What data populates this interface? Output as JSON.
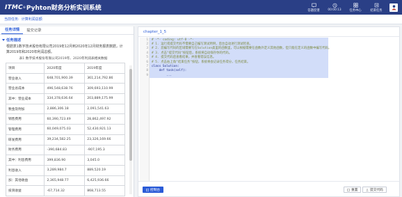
{
  "app": {
    "logo": "ITMC",
    "reg": "®",
    "title": "Pyhton财务分析实训系统"
  },
  "top_actions": [
    {
      "label": "答题反馈",
      "icon": "feedback-icon"
    },
    {
      "label": "00:00:13",
      "icon": "timer-icon"
    },
    {
      "label": "任务中心",
      "icon": "task-center-icon"
    },
    {
      "label": "结束任务",
      "icon": "end-task-icon"
    }
  ],
  "subbar": {
    "label": "当前任务:",
    "value": "计算利润总额"
  },
  "left": {
    "tabs": [
      "任务详情",
      "提交记录"
    ],
    "section_title": "任务描述",
    "description": "根据表1数字技术股份有限公司2019年12月到2020年12月财务报表数据，计算2019年和2020年利润总额。",
    "table_caption": "表1 数字技术股份有限公司2019年、2020年利润表相关数据",
    "table_rows": [
      [
        "项目",
        "2020年度",
        "2019年度"
      ],
      [
        "营业收入",
        "648,701,900.39",
        "361,214,792.86"
      ],
      [
        "营业总成本",
        "496,548,638.76",
        "309,693,110.99"
      ],
      [
        "其中：营业成本",
        "334,378,636.64",
        "203,889,175.99"
      ],
      [
        "税金及附加",
        "2,886,306.18",
        "2,091,541.63"
      ],
      [
        "销售费用",
        "60,390,723.49",
        "28,862,497.92"
      ],
      [
        "管理费用",
        "60,049,075.03",
        "52,430,921.13"
      ],
      [
        "研发费用",
        "39,234,582.25",
        "23,326,169.66"
      ],
      [
        "财务费用",
        "-390,684.83",
        "-907,195.3"
      ],
      [
        "其中：利息费用",
        "399,836.90",
        "3,045.0"
      ],
      [
        "利息收入",
        "3,289,984.7",
        "889,520.19"
      ],
      [
        "加：其他收益",
        "2,365,948.77",
        "6,425,936.66"
      ],
      [
        "投资收益",
        "-67,714.32",
        "868,713.55"
      ]
    ]
  },
  "editor": {
    "filename": "chapter_1_5",
    "lines": [
      {
        "n": "1",
        "t": "# -*- coding: utf-8 -*-"
      },
      {
        "n": "2",
        "t": "# 1. 运行或提交代码不需要自己编写测试用例，后台自动进行测试检查。"
      },
      {
        "n": "3",
        "t": "# 2. 您编写代码的区域需要写在Solution类里的函数里，可以根据需要在函数外定义其他函数，但只能在定义的函数中编写代码。"
      },
      {
        "n": "4",
        "t": "# 3. 点击\"提交代码\"按钮后，系统将自动保存你的代码。"
      },
      {
        "n": "5",
        "t": "# 4. 提交代码后查看结果，并查看错误信息。"
      },
      {
        "n": "6",
        "t": "# 5. 点击右上角\"结束任务\"按钮，系统将会记录任务得分，任务结束。"
      },
      {
        "n": "7",
        "t": "class Solution:"
      },
      {
        "n": "8",
        "t": "    def task(self):"
      },
      {
        "n": "9",
        "t": "        ..."
      }
    ],
    "console_label": "控制台",
    "reset_label": "重置",
    "submit_label": "提交代码"
  },
  "colors": {
    "topbar": "#2a3f86",
    "accent": "#2a5bd7",
    "selection": "#d2ddf9"
  }
}
